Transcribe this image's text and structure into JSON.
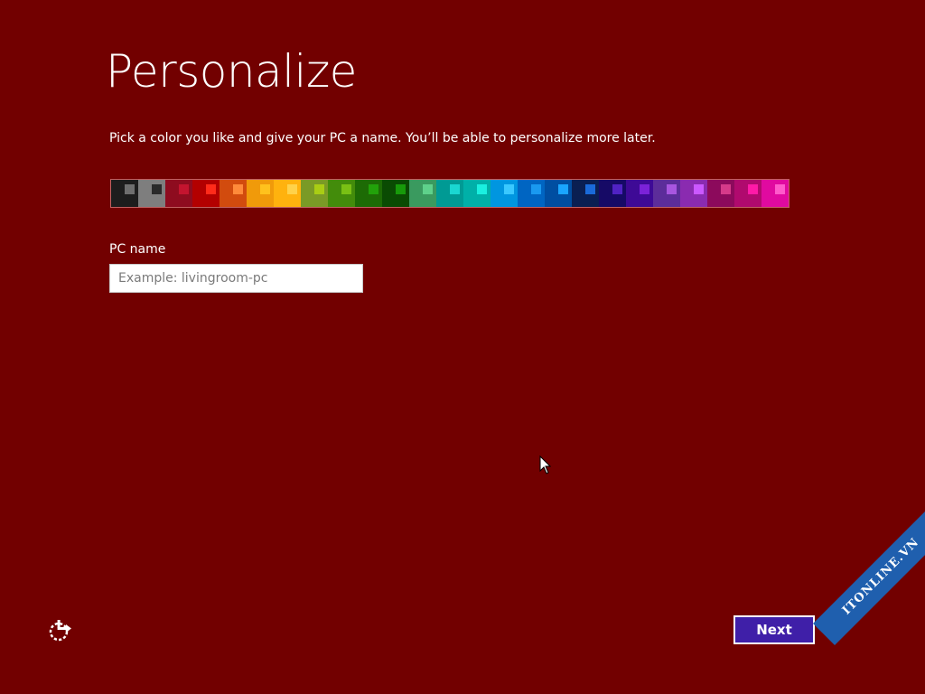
{
  "title": "Personalize",
  "subtitle": "Pick a color you like and give your PC a name. You’ll be able to personalize more later.",
  "palette": {
    "swatches": [
      {
        "bg": "#1d1d1d",
        "accent": "#6e6e6e"
      },
      {
        "bg": "#7e7e7e",
        "accent": "#2a2a2a"
      },
      {
        "bg": "#8e0c1f",
        "accent": "#c4142f"
      },
      {
        "bg": "#b30000",
        "accent": "#ff2b1a"
      },
      {
        "bg": "#d24b0e",
        "accent": "#ff8a3a"
      },
      {
        "bg": "#f09a0a",
        "accent": "#ffc21d"
      },
      {
        "bg": "#ffb20e",
        "accent": "#ffd24a"
      },
      {
        "bg": "#7a9a26",
        "accent": "#a9cd14"
      },
      {
        "bg": "#438c0b",
        "accent": "#79c014"
      },
      {
        "bg": "#1d6b05",
        "accent": "#22a20a"
      },
      {
        "bg": "#0a4b03",
        "accent": "#179a0a"
      },
      {
        "bg": "#3a9a5f",
        "accent": "#5ed18b"
      },
      {
        "bg": "#009a94",
        "accent": "#1ad7d1"
      },
      {
        "bg": "#00b0a8",
        "accent": "#1af0e0"
      },
      {
        "bg": "#0096e0",
        "accent": "#3ac8ff"
      },
      {
        "bg": "#0065c2",
        "accent": "#1a99f0"
      },
      {
        "bg": "#004ea1",
        "accent": "#1aa5ff"
      },
      {
        "bg": "#0a1f52",
        "accent": "#1a6ad8"
      },
      {
        "bg": "#160a66",
        "accent": "#5022c4"
      },
      {
        "bg": "#3e0a96",
        "accent": "#7b22d8"
      },
      {
        "bg": "#5c2d9a",
        "accent": "#a856e0"
      },
      {
        "bg": "#8a2bb0",
        "accent": "#cb58ff"
      },
      {
        "bg": "#8c0a5c",
        "accent": "#d63a8a"
      },
      {
        "bg": "#b00a6e",
        "accent": "#ff1aa8"
      },
      {
        "bg": "#e00aa0",
        "accent": "#ff5acb"
      }
    ]
  },
  "pc_name": {
    "label": "PC name",
    "value": "",
    "placeholder": "Example: livingroom-pc"
  },
  "footer": {
    "ease_of_access_icon": "ease-of-access-icon",
    "next_label": "Next"
  },
  "watermark": "ITONLINE.VN"
}
